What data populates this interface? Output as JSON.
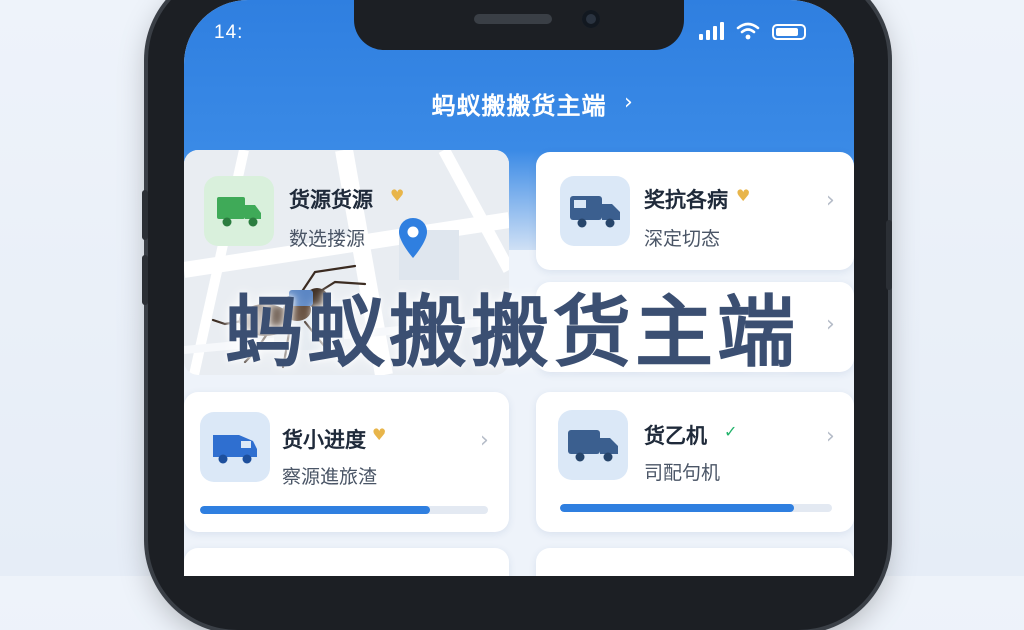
{
  "status_bar": {
    "time": "14:"
  },
  "nav": {
    "title": "蚂蚁搬搬货主端",
    "chevron": "›"
  },
  "cards": [
    {
      "title": "货源货源",
      "subtitle": "数选搂源",
      "badge": "♥"
    },
    {
      "title": "奖抗各病",
      "subtitle": "深定切态",
      "badge": "♥"
    },
    {
      "title": "货小进度",
      "subtitle": "察源進旅渣",
      "badge": "♥",
      "progress": 0.8
    },
    {
      "title": "货乙机",
      "subtitle": "司配句机",
      "badge": "✓",
      "progress": 0.86
    }
  ],
  "overlay_title": "蚂蚁搬搬货主端",
  "colors": {
    "brand": "#2f7fe0",
    "accent_gold": "#e8b54a",
    "check_green": "#22b36b"
  },
  "icons": {
    "card1": "truck-icon",
    "card2": "truck-icon",
    "card3": "van-icon",
    "card4": "truck-icon",
    "map_pin": "map-pin-icon"
  }
}
